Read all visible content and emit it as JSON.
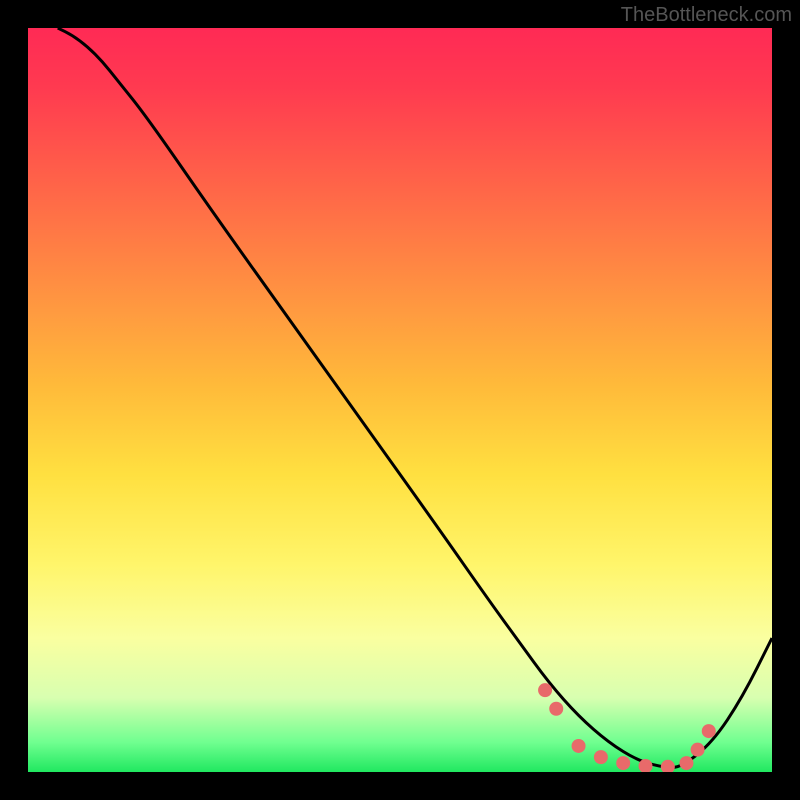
{
  "watermark": "TheBottleneck.com",
  "chart_data": {
    "type": "line",
    "title": "",
    "xlabel": "",
    "ylabel": "",
    "xlim": [
      0,
      100
    ],
    "ylim": [
      0,
      100
    ],
    "series": [
      {
        "name": "curve",
        "x": [
          4,
          6,
          8,
          10,
          12,
          16,
          25,
          35,
          45,
          55,
          62,
          66,
          70,
          74,
          78,
          82,
          86,
          88,
          92,
          96,
          100
        ],
        "y": [
          100,
          99,
          97.5,
          95.5,
          93,
          88,
          75,
          61,
          47,
          33,
          23,
          17.5,
          12,
          7.5,
          4,
          1.5,
          0.5,
          0.8,
          4,
          10,
          18
        ]
      }
    ],
    "markers": {
      "name": "dots",
      "x": [
        69.5,
        71,
        74,
        77,
        80,
        83,
        86,
        88.5,
        90,
        91.5
      ],
      "y": [
        11,
        8.5,
        3.5,
        2,
        1.2,
        0.8,
        0.7,
        1.2,
        3,
        5.5
      ]
    },
    "gradient_stops": [
      {
        "pos": 0,
        "color": "#ff2a55"
      },
      {
        "pos": 50,
        "color": "#ffba3a"
      },
      {
        "pos": 80,
        "color": "#fff56a"
      },
      {
        "pos": 100,
        "color": "#20e860"
      }
    ]
  }
}
